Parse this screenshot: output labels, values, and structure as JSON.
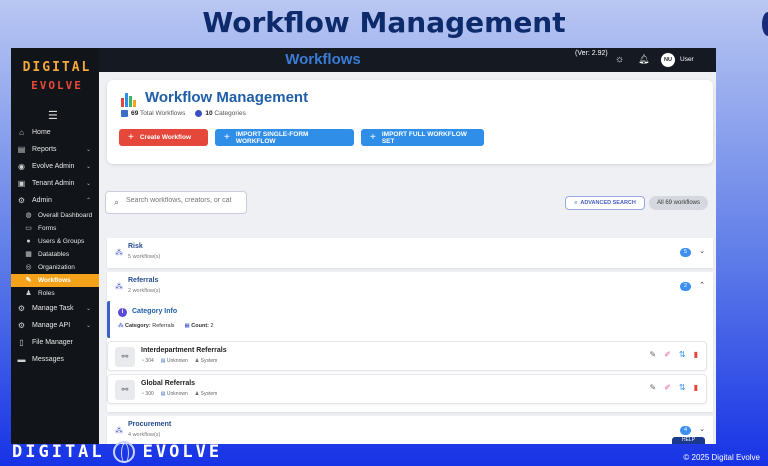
{
  "slide": {
    "title": "Workflow Management",
    "footer_logo": "DIGITAL",
    "footer_logo2": "EVOLVE",
    "copyright": "© 2025 Digital Evolve"
  },
  "sidebar": {
    "logo_line1": "DIGITAL",
    "logo_line2": "EVOLVE",
    "items": [
      {
        "label": "Home",
        "icon": "home-icon"
      },
      {
        "label": "Reports",
        "icon": "reports-icon",
        "chevron": "⌄"
      },
      {
        "label": "Evolve Admin",
        "icon": "admin-icon",
        "chevron": "⌄"
      },
      {
        "label": "Tenant Admin",
        "icon": "tenant-icon",
        "chevron": "⌄"
      },
      {
        "label": "Admin",
        "icon": "gear-icon",
        "chevron": "⌃"
      },
      {
        "label": "Overall Dashboard",
        "icon": "dashboard-icon"
      },
      {
        "label": "Forms",
        "icon": "forms-icon"
      },
      {
        "label": "Users & Groups",
        "icon": "users-icon"
      },
      {
        "label": "Datatables",
        "icon": "table-icon"
      },
      {
        "label": "Organization",
        "icon": "org-icon"
      },
      {
        "label": "Workflows",
        "icon": "workflow-icon"
      },
      {
        "label": "Roles",
        "icon": "roles-icon"
      },
      {
        "label": "Manage Task",
        "icon": "task-icon",
        "chevron": "⌄"
      },
      {
        "label": "Manage API",
        "icon": "api-icon",
        "chevron": "⌄"
      },
      {
        "label": "File Manager",
        "icon": "file-icon"
      },
      {
        "label": "Messages",
        "icon": "message-icon"
      }
    ]
  },
  "topbar": {
    "title": "Workflows",
    "version": "(Ver: 2.92)",
    "avatar": "NU",
    "user": "User"
  },
  "header": {
    "title": "Workflow Management",
    "total_count": "69",
    "total_label": "Total Workflows",
    "cat_count": "10",
    "cat_label": "Categories",
    "create_label": "Create Workflow",
    "import_single_label": "IMPORT SINGLE-FORM WORKFLOW",
    "import_full_label": "IMPORT FULL WORKFLOW SET"
  },
  "filter": {
    "search_placeholder": "Search workflows, creators, or cat",
    "advanced_label": "ADVANCED SEARCH",
    "all_label": "All 69 workflows"
  },
  "categories": [
    {
      "name": "Risk",
      "count_label": "5 workflow(s)",
      "badge": "5",
      "chevron": "⌄"
    },
    {
      "name": "Referrals",
      "count_label": "2 workflow(s)",
      "badge": "2",
      "chevron": "⌃"
    },
    {
      "name": "Procurement",
      "count_label": "4 workflow(s)",
      "badge": "4",
      "chevron": "⌄"
    }
  ],
  "category_info": {
    "title": "Category Info",
    "category_label": "Category:",
    "category_value": "Referrals",
    "count_label": "Count:",
    "count_value": "2"
  },
  "workflows": [
    {
      "name": "Interdepartment Referrals",
      "views": "304",
      "date": "Unknown",
      "creator": "System"
    },
    {
      "name": "Global Referrals",
      "views": "300",
      "date": "Unknown",
      "creator": "System"
    }
  ],
  "help_label": "HELP",
  "colors": {
    "accent": "#f5a21b",
    "primary": "#2f8ee8",
    "danger": "#e5483a",
    "title": "#1f5ea8"
  }
}
